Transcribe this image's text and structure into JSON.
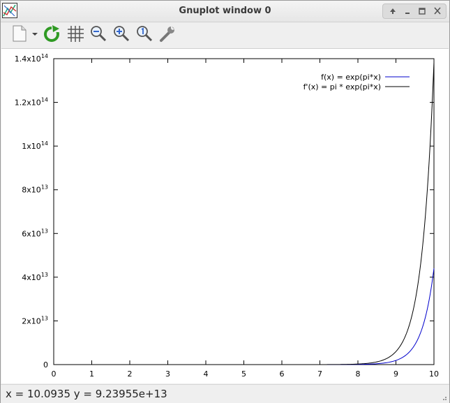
{
  "window": {
    "title": "Gnuplot window 0"
  },
  "toolbar": {
    "buttons": [
      {
        "name": "copy-to-clipboard",
        "icon": "document-icon"
      },
      {
        "name": "replot",
        "icon": "refresh-icon"
      },
      {
        "name": "grid",
        "icon": "grid-icon"
      },
      {
        "name": "zoom-previous",
        "icon": "zoom-out-icon"
      },
      {
        "name": "zoom-next",
        "icon": "zoom-in-icon"
      },
      {
        "name": "autoscale",
        "icon": "zoom-reset-icon"
      },
      {
        "name": "preferences",
        "icon": "wrench-icon"
      }
    ]
  },
  "status": {
    "coordinates": "x = 10.0935 y = 9.23955e+13"
  },
  "colors": {
    "series_blue": "#0000cc",
    "series_black": "#000000"
  },
  "chart_data": {
    "type": "line",
    "xlim": [
      0,
      10
    ],
    "ylim": [
      0,
      140000000000000
    ],
    "x_ticks": [
      "0",
      "1",
      "2",
      "3",
      "4",
      "5",
      "6",
      "7",
      "8",
      "9",
      "10"
    ],
    "y_ticks": [
      {
        "value": 0,
        "mantissa": "0",
        "exp": ""
      },
      {
        "value": 20000000000000,
        "mantissa": "2x10",
        "exp": "13"
      },
      {
        "value": 40000000000000,
        "mantissa": "4x10",
        "exp": "13"
      },
      {
        "value": 60000000000000,
        "mantissa": "6x10",
        "exp": "13"
      },
      {
        "value": 80000000000000,
        "mantissa": "8x10",
        "exp": "13"
      },
      {
        "value": 100000000000000,
        "mantissa": "1x10",
        "exp": "14"
      },
      {
        "value": 120000000000000,
        "mantissa": "1.2x10",
        "exp": "14"
      },
      {
        "value": 140000000000000,
        "mantissa": "1.4x10",
        "exp": "14"
      }
    ],
    "legend_position": "top-right",
    "series": [
      {
        "name": "f(x) = exp(pi*x)",
        "formula": "exp",
        "color": "#0000cc"
      },
      {
        "name": "f'(x) = pi * exp(pi*x)",
        "formula": "pi_exp",
        "color": "#000000"
      }
    ]
  }
}
